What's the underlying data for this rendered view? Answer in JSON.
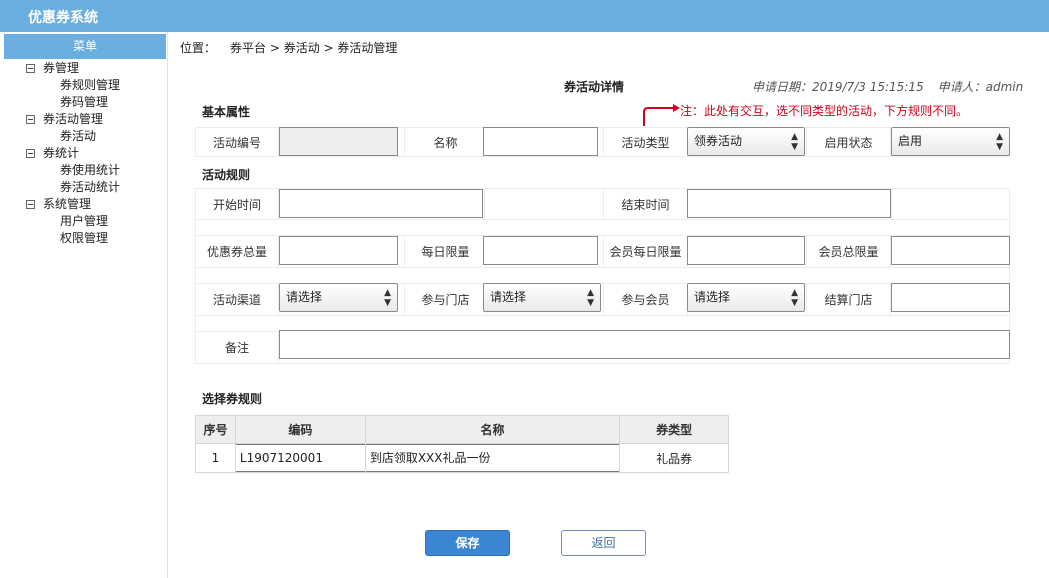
{
  "app": {
    "title": "优惠券系统"
  },
  "sidebar": {
    "header": "菜单",
    "groups": [
      {
        "label": "券管理",
        "items": [
          "券规则管理",
          "券码管理"
        ]
      },
      {
        "label": "券活动管理",
        "items": [
          "券活动"
        ]
      },
      {
        "label": "券统计",
        "items": [
          "券使用统计",
          "券活动统计"
        ]
      },
      {
        "label": "系统管理",
        "items": [
          "用户管理",
          "权限管理"
        ]
      }
    ]
  },
  "breadcrumb": {
    "label": "位置：",
    "path": "券平台  > 券活动 > 券活动管理"
  },
  "detail": {
    "title": "券活动详情",
    "apply_date": "申请日期：2019/7/3 15:15:15",
    "applicant": "申请人：admin"
  },
  "note": "注：此处有交互，选不同类型的活动，下方规则不同。",
  "basic": {
    "section_title": "基本属性",
    "activity_no_label": "活动编号",
    "activity_no_value": "",
    "name_label": "名称",
    "name_value": "",
    "type_label": "活动类型",
    "type_value": "领券活动",
    "status_label": "启用状态",
    "status_value": "启用"
  },
  "rules": {
    "section_title": "活动规则",
    "start_label": "开始时间",
    "end_label": "结束时间",
    "total_label": "优惠券总量",
    "daily_label": "每日限量",
    "member_daily_label": "会员每日限量",
    "member_total_label": "会员总限量",
    "channel_label": "活动渠道",
    "channel_value": "请选择",
    "store_label": "参与门店",
    "store_value": "请选择",
    "member_label": "参与会员",
    "member_value": "请选择",
    "settle_label": "结算门店",
    "remark_label": "备注"
  },
  "coupon_rules": {
    "title": "选择券规则",
    "headers": [
      "序号",
      "编码",
      "名称",
      "券类型"
    ],
    "rows": [
      [
        "1",
        "L1907120001",
        "到店领取XXX礼品一份",
        "礼品券"
      ]
    ]
  },
  "buttons": {
    "save": "保存",
    "back": "返回"
  },
  "colors": {
    "topbar": "#6aaee0",
    "primary": "#3b86d4",
    "note": "#d0021b"
  }
}
